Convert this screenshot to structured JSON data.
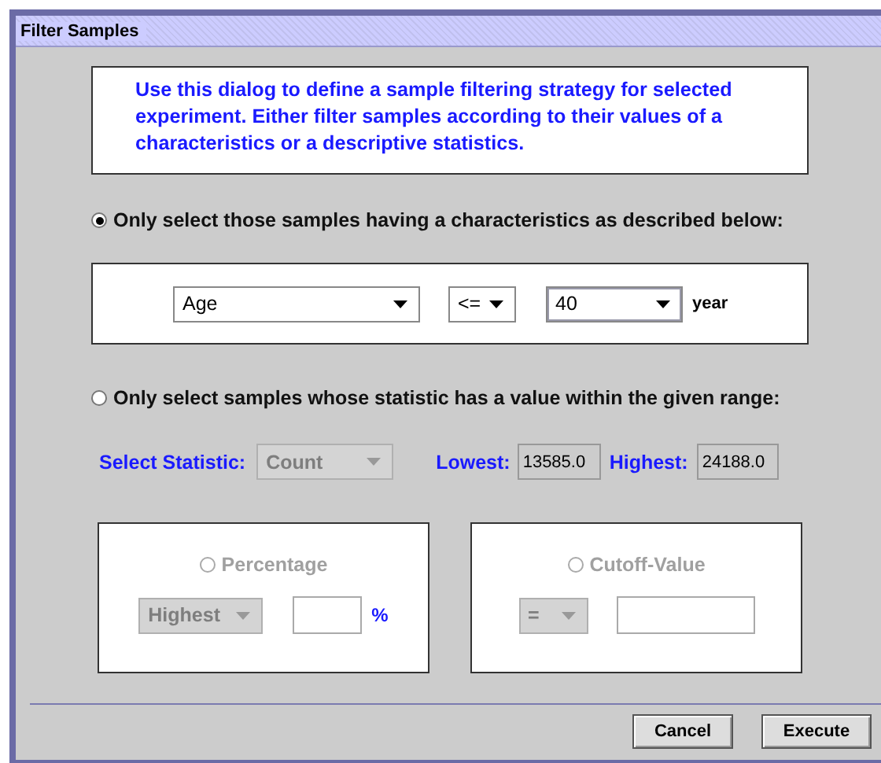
{
  "window": {
    "title": "Filter Samples"
  },
  "description": "Use this dialog to define a sample filtering strategy for selected experiment. Either filter samples according to their values of a characteristics or a descriptive statistics.",
  "options": [
    {
      "label": "Only select those samples having a characteristics as described below:",
      "selected": true
    },
    {
      "label": "Only select samples whose statistic has a value within the given range:",
      "selected": false
    }
  ],
  "characteristic": {
    "attribute": "Age",
    "operator": "<=",
    "value": "40",
    "unit": "year",
    "disabled": false
  },
  "statistic": {
    "label": "Select Statistic:",
    "value": "Count",
    "disabled": true,
    "lowest_label": "Lowest:",
    "lowest": "13585.0",
    "highest_label": "Highest:",
    "highest": "24188.0"
  },
  "cutoff_modes": [
    {
      "label": "Percentage",
      "selected": false,
      "disabled": true,
      "combo": "Highest",
      "unit": "%"
    },
    {
      "label": "Cutoff-Value",
      "selected": false,
      "disabled": true,
      "combo": "="
    }
  ],
  "buttons": [
    "Cancel",
    "Execute"
  ]
}
